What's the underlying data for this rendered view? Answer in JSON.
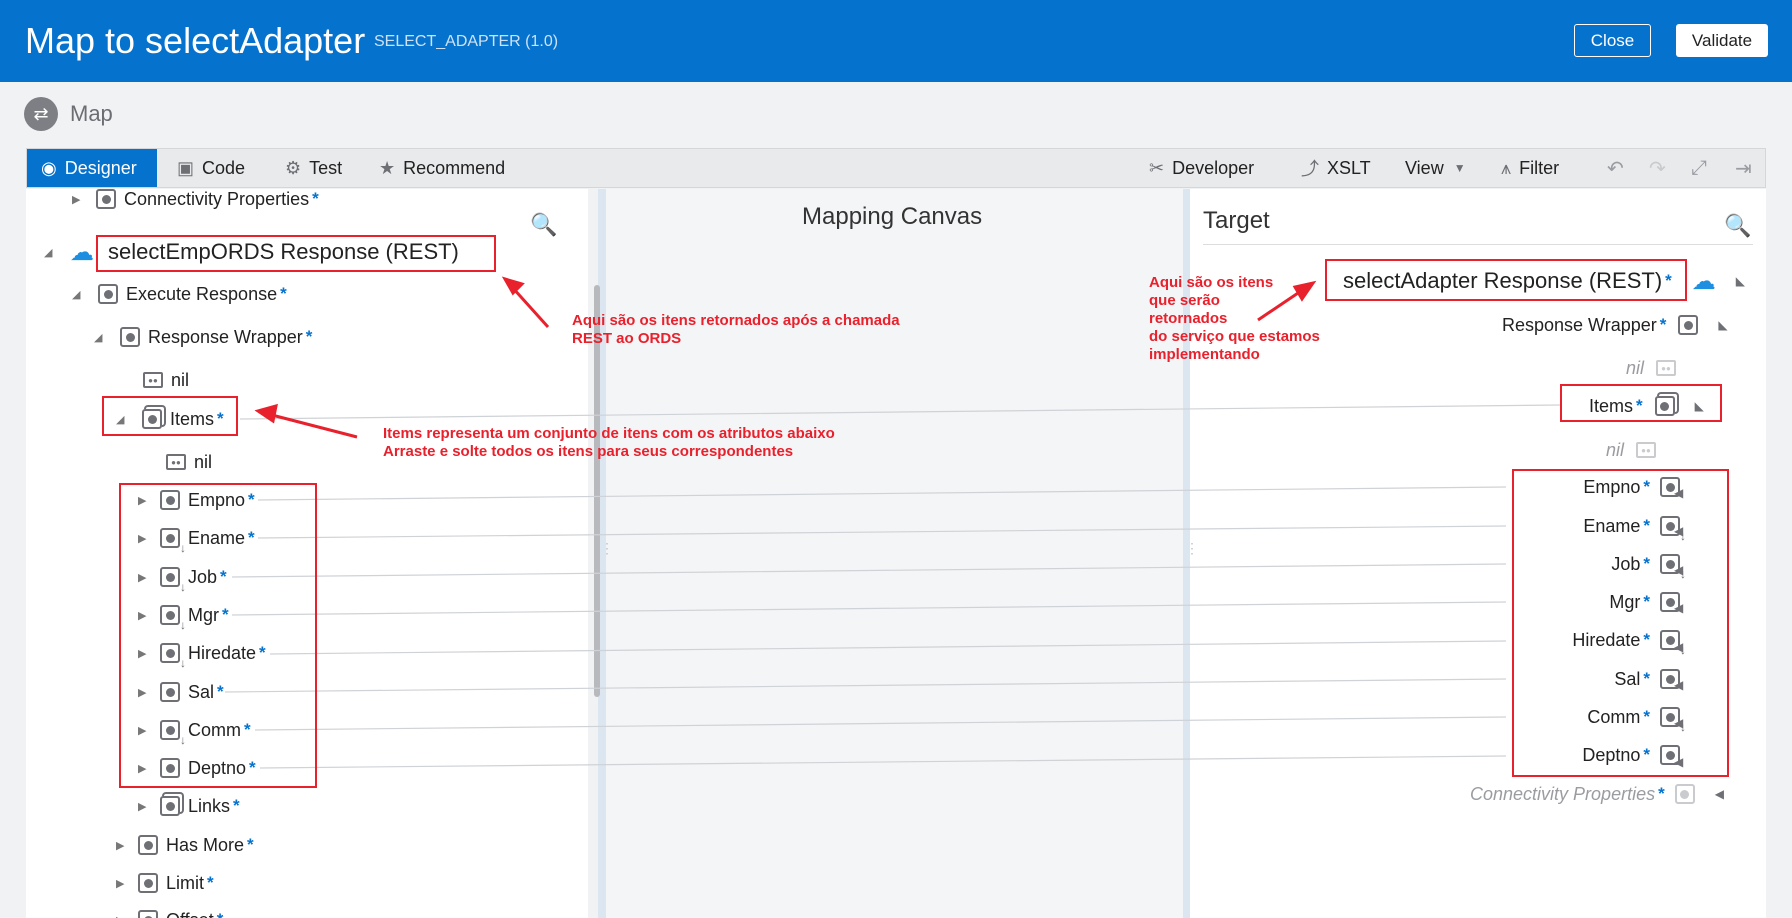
{
  "header": {
    "title": "Map to selectAdapter",
    "subtitle": "SELECT_ADAPTER (1.0)",
    "close_label": "Close",
    "validate_label": "Validate"
  },
  "map_label": "Map",
  "toolbar": {
    "designer": "Designer",
    "code": "Code",
    "test": "Test",
    "recommend": "Recommend",
    "developer": "Developer",
    "xslt": "XSLT",
    "view": "View",
    "filter": "Filter"
  },
  "source": {
    "connectivity": "Connectivity Properties",
    "root": "selectEmpORDS Response (REST)",
    "execute": "Execute Response",
    "wrapper": "Response Wrapper",
    "nil": "nil",
    "items": "Items",
    "items_nil": "nil",
    "fields": [
      "Empno",
      "Ename",
      "Job",
      "Mgr",
      "Hiredate",
      "Sal",
      "Comm",
      "Deptno"
    ],
    "links": "Links",
    "has_more": "Has More",
    "limit": "Limit",
    "offset": "Offset"
  },
  "canvas": {
    "title": "Mapping Canvas"
  },
  "target": {
    "title": "Target",
    "root": "selectAdapter Response (REST)",
    "wrapper": "Response Wrapper",
    "nil": "nil",
    "items": "Items",
    "items_nil": "nil",
    "fields": [
      "Empno",
      "Ename",
      "Job",
      "Mgr",
      "Hiredate",
      "Sal",
      "Comm",
      "Deptno"
    ],
    "connectivity": "Connectivity Properties"
  },
  "annotations": {
    "source_response": "Aqui são os itens retornados após a chamada\nREST ao ORDS",
    "items": "Items representa um conjunto de itens com os atributos abaixo\nArraste e solte todos os itens para seus correspondentes",
    "target_response": "Aqui são os itens\nque serão\nretornados\ndo serviço que estamos\nimplementando"
  },
  "colors": {
    "header_bg": "#0572ce",
    "accent": "#0572ce",
    "annotation_red": "#e8212c"
  }
}
